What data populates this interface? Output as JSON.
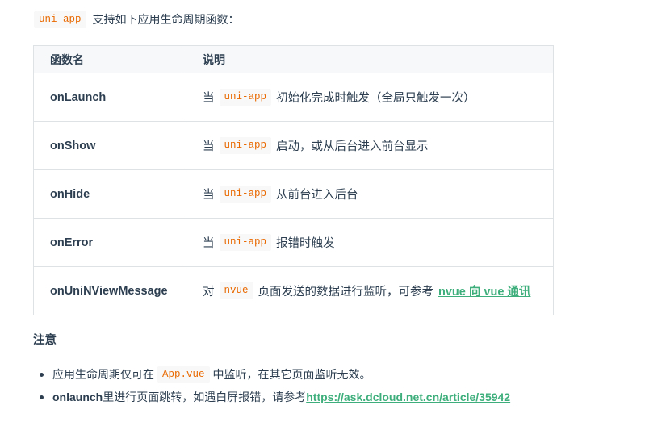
{
  "intro": {
    "code": "uni-app",
    "text": "支持如下应用生命周期函数："
  },
  "table": {
    "headers": [
      "函数名",
      "说明"
    ],
    "rows": [
      {
        "fn": "onLaunch",
        "prefix": "当",
        "code": "uni-app",
        "text": "初始化完成时触发（全局只触发一次）"
      },
      {
        "fn": "onShow",
        "prefix": "当",
        "code": "uni-app",
        "text": "启动，或从后台进入前台显示"
      },
      {
        "fn": "onHide",
        "prefix": "当",
        "code": "uni-app",
        "text": "从前台进入后台"
      },
      {
        "fn": "onError",
        "prefix": "当",
        "code": "uni-app",
        "text": "报错时触发"
      },
      {
        "fn": "onUniNViewMessage",
        "prefix": "对",
        "code": "nvue",
        "text": "页面发送的数据进行监听，可参考",
        "link": "nvue 向 vue 通讯"
      }
    ]
  },
  "notes": {
    "title": "注意",
    "items": [
      {
        "before": "应用生命周期仅可在",
        "code": "App.vue",
        "after": "中监听，在其它页面监听无效。"
      },
      {
        "bold": "onlaunch",
        "text": "里进行页面跳转，如遇白屏报错，请参考",
        "link": "https://ask.dcloud.net.cn/article/35942"
      }
    ]
  },
  "colors": {
    "text": "#2c3e50",
    "code": "#e96900",
    "code_bg": "#f8f8f8",
    "link": "#3eaf7c",
    "border": "#dfe2e5",
    "header_bg": "#f6f8fa"
  }
}
